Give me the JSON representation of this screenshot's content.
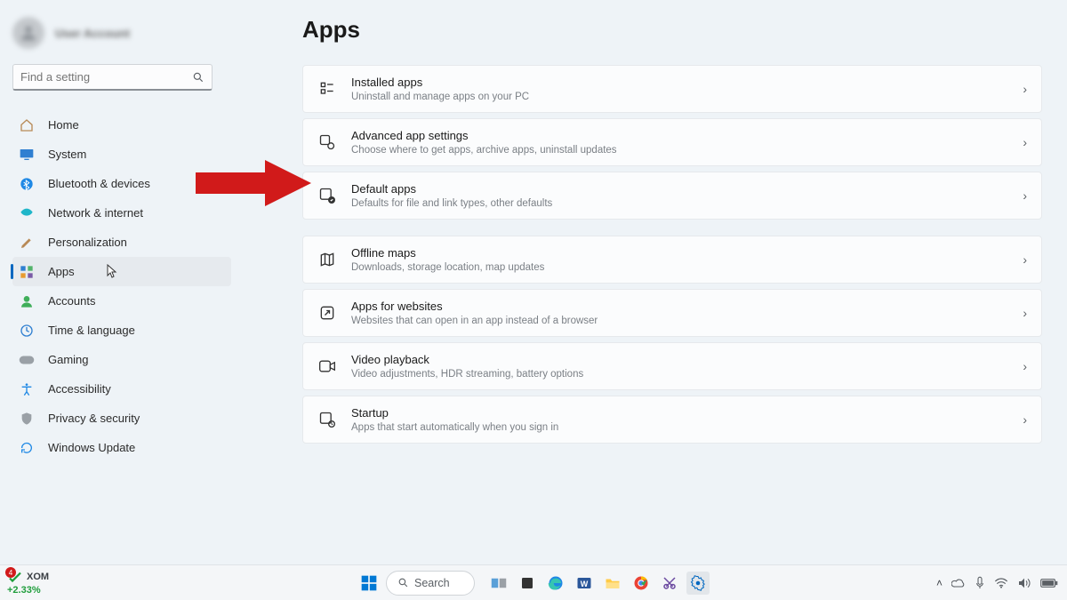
{
  "user": {
    "name": "User Account"
  },
  "search": {
    "placeholder": "Find a setting"
  },
  "nav": [
    {
      "label": "Home",
      "icon": "home-icon"
    },
    {
      "label": "System",
      "icon": "system-icon"
    },
    {
      "label": "Bluetooth & devices",
      "icon": "bluetooth-icon"
    },
    {
      "label": "Network & internet",
      "icon": "network-icon"
    },
    {
      "label": "Personalization",
      "icon": "personalization-icon"
    },
    {
      "label": "Apps",
      "icon": "apps-icon",
      "active": true
    },
    {
      "label": "Accounts",
      "icon": "accounts-icon"
    },
    {
      "label": "Time & language",
      "icon": "time-language-icon"
    },
    {
      "label": "Gaming",
      "icon": "gaming-icon"
    },
    {
      "label": "Accessibility",
      "icon": "accessibility-icon"
    },
    {
      "label": "Privacy & security",
      "icon": "privacy-icon"
    },
    {
      "label": "Windows Update",
      "icon": "update-icon"
    }
  ],
  "page": {
    "title": "Apps"
  },
  "cards": [
    {
      "title": "Installed apps",
      "sub": "Uninstall and manage apps on your PC",
      "icon": "installed-apps-icon"
    },
    {
      "title": "Advanced app settings",
      "sub": "Choose where to get apps, archive apps, uninstall updates",
      "icon": "advanced-settings-icon"
    },
    {
      "title": "Default apps",
      "sub": "Defaults for file and link types, other defaults",
      "icon": "default-apps-icon",
      "highlight": true
    },
    {
      "title": "Offline maps",
      "sub": "Downloads, storage location, map updates",
      "icon": "offline-maps-icon"
    },
    {
      "title": "Apps for websites",
      "sub": "Websites that can open in an app instead of a browser",
      "icon": "apps-for-websites-icon"
    },
    {
      "title": "Video playback",
      "sub": "Video adjustments, HDR streaming, battery options",
      "icon": "video-playback-icon"
    },
    {
      "title": "Startup",
      "sub": "Apps that start automatically when you sign in",
      "icon": "startup-icon"
    }
  ],
  "taskbar": {
    "stock": {
      "ticker": "XOM",
      "change": "+2.33%",
      "badge": "4"
    },
    "search_label": "Search",
    "apps": [
      {
        "name": "start",
        "icon": "windows-logo-icon"
      },
      {
        "name": "task-view",
        "icon": "task-view-icon"
      },
      {
        "name": "widgets",
        "icon": "widgets-icon"
      },
      {
        "name": "edge",
        "icon": "edge-icon"
      },
      {
        "name": "word",
        "icon": "word-icon"
      },
      {
        "name": "explorer",
        "icon": "file-explorer-icon"
      },
      {
        "name": "chrome",
        "icon": "chrome-icon"
      },
      {
        "name": "snip",
        "icon": "snip-icon"
      },
      {
        "name": "settings",
        "icon": "settings-icon",
        "active": true
      }
    ],
    "tray": [
      "chevron-up-icon",
      "onedrive-icon",
      "mic-icon",
      "wifi-icon",
      "volume-icon",
      "battery-icon"
    ]
  }
}
